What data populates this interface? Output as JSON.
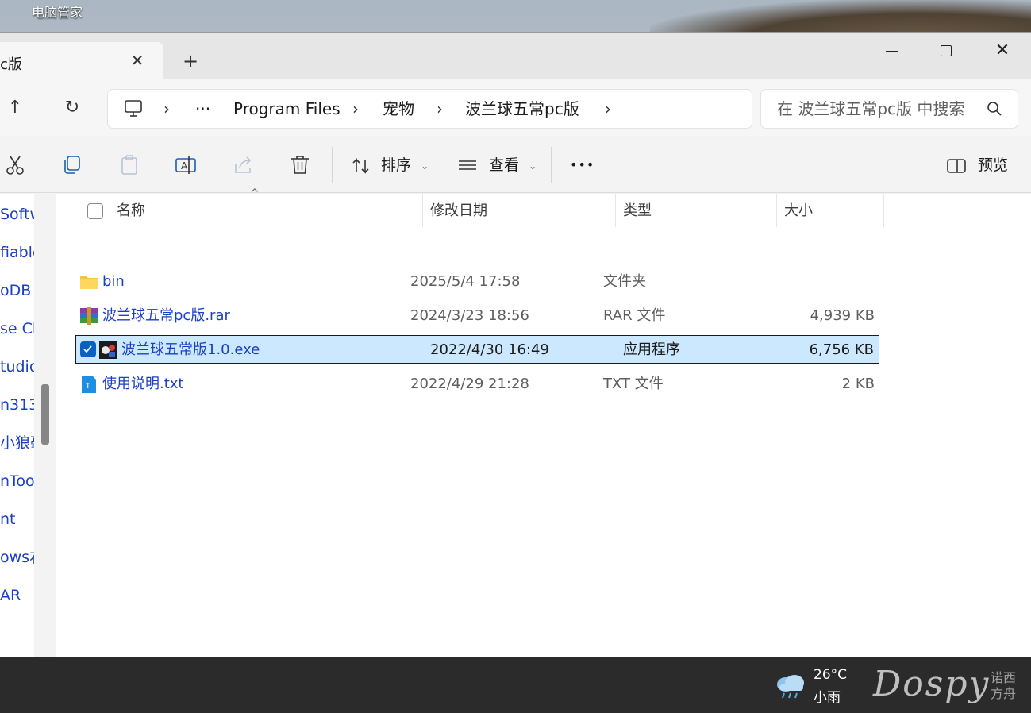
{
  "desktop": {
    "label": "电脑管家"
  },
  "tab": {
    "title": "c版",
    "close_glyph": "✕",
    "new_glyph": "+"
  },
  "window_controls": {
    "close_glyph": "✕"
  },
  "nav": {
    "up_glyph": "↑",
    "refresh_glyph": "↻"
  },
  "address": {
    "overflow": "···",
    "crumbs": [
      "Program Files",
      "宠物",
      "波兰球五常pc版"
    ],
    "chevron": "›"
  },
  "search": {
    "placeholder": "在 波兰球五常pc版 中搜索"
  },
  "commands": {
    "sort_label": "排序",
    "view_label": "查看",
    "more_glyph": "•••",
    "preview_label": "预览",
    "chevron_small": "⌄"
  },
  "sidebar": {
    "items": [
      "Softw",
      "fiable",
      "oDB",
      "se Cl",
      "tudio",
      "n313",
      "小狼毫",
      "nTool",
      "nt",
      "ows右",
      "AR"
    ]
  },
  "columns": {
    "name": "名称",
    "date": "修改日期",
    "type": "类型",
    "size": "大小",
    "sort_caret": "^"
  },
  "files": [
    {
      "name": "bin",
      "date": "2025/5/4 17:58",
      "type": "文件夹",
      "size": "",
      "icon": "folder-icon",
      "selected": false
    },
    {
      "name": "波兰球五常pc版.rar",
      "date": "2024/3/23 18:56",
      "type": "RAR 文件",
      "size": "4,939 KB",
      "icon": "winrar-icon",
      "selected": false
    },
    {
      "name": "波兰球五常版1.0.exe",
      "date": "2022/4/30 16:49",
      "type": "应用程序",
      "size": "6,756 KB",
      "icon": "exe-icon",
      "selected": true
    },
    {
      "name": "使用说明.txt",
      "date": "2022/4/29 21:28",
      "type": "TXT 文件",
      "size": "2 KB",
      "icon": "txt-icon",
      "selected": false
    }
  ],
  "taskbar": {
    "temperature": "26°C",
    "condition": "小雨",
    "watermark": "Dospy",
    "watermark_cn": "诺西方舟"
  },
  "colors": {
    "accent": "#0a5fc2",
    "selection": "#cce8ff",
    "link": "#1a3fc7"
  }
}
